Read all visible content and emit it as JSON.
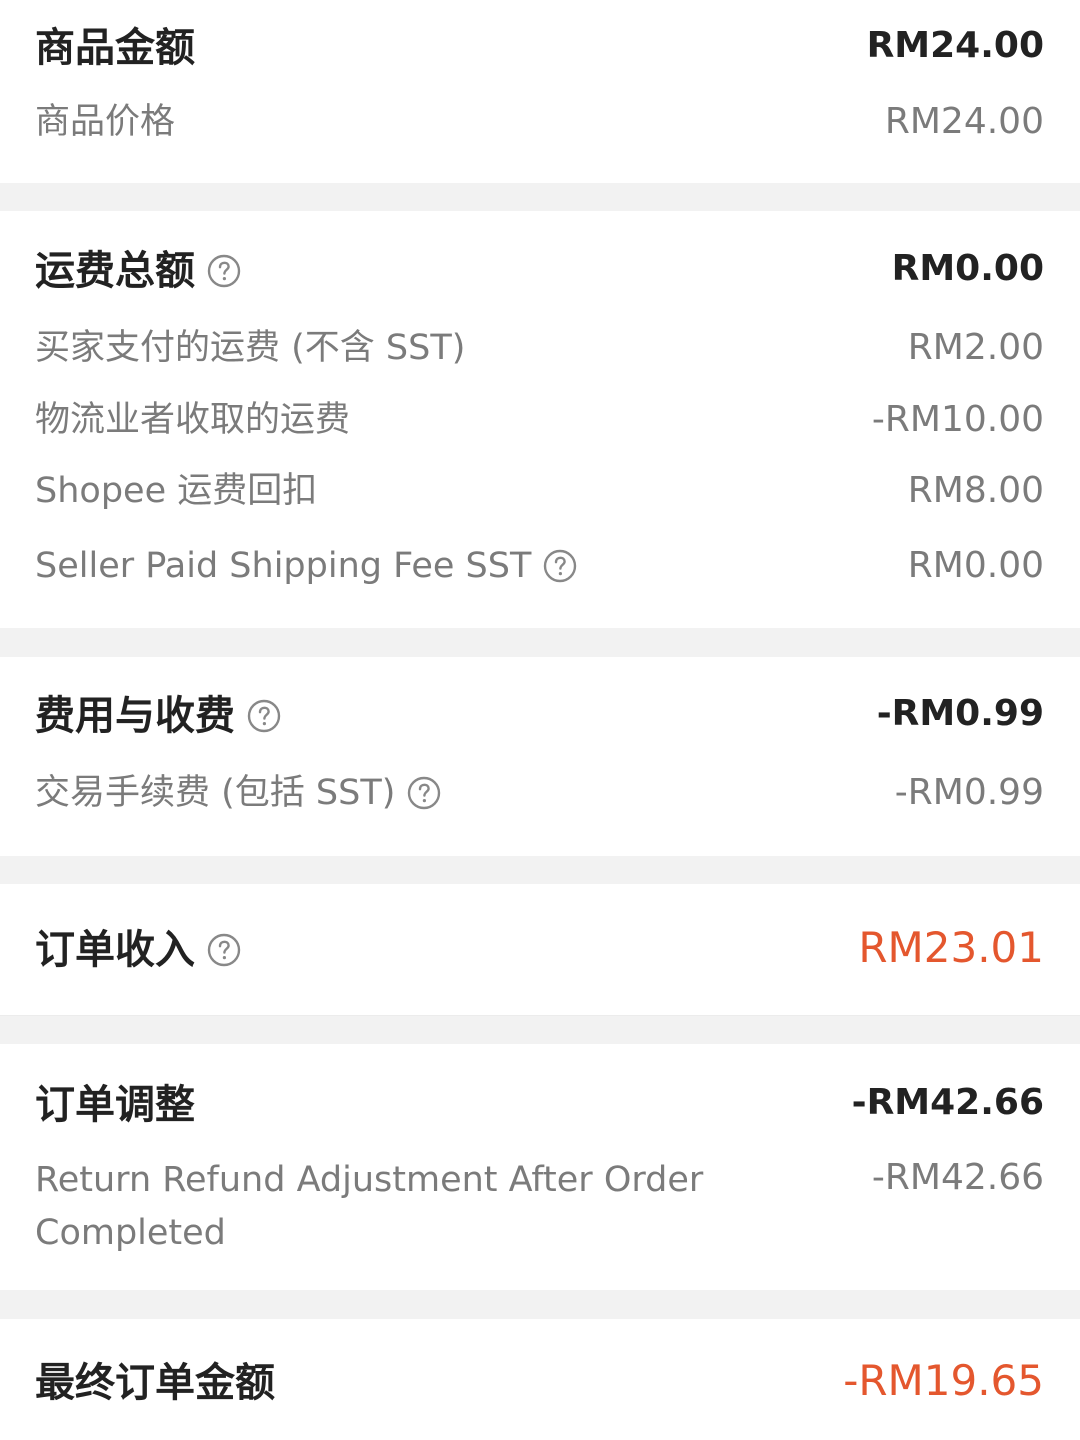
{
  "product": {
    "title": "商品金额",
    "total": "RM24.00",
    "items": [
      {
        "label": "商品价格",
        "value": "RM24.00"
      }
    ]
  },
  "shipping": {
    "title": "运费总额",
    "total": "RM0.00",
    "items": [
      {
        "label": "买家支付的运费 (不含 SST)",
        "value": "RM2.00"
      },
      {
        "label": "物流业者收取的运费",
        "value": "-RM10.00"
      },
      {
        "label": "Shopee 运费回扣",
        "value": "RM8.00"
      },
      {
        "label": "Seller Paid Shipping Fee SST",
        "value": "RM0.00"
      }
    ]
  },
  "fees": {
    "title": "费用与收费",
    "total": "-RM0.99",
    "items": [
      {
        "label": "交易手续费 (包括 SST)",
        "value": "-RM0.99"
      }
    ]
  },
  "income": {
    "title": "订单收入",
    "total": "RM23.01"
  },
  "adjustment": {
    "title": "订单调整",
    "total": "-RM42.66",
    "items": [
      {
        "label": "Return Refund Adjustment After Order Completed",
        "value": "-RM42.66"
      }
    ]
  },
  "final": {
    "title": "最终订单金额",
    "total": "-RM19.65"
  },
  "colors": {
    "accent": "#e4572e",
    "title_text": "#222222",
    "secondary_text": "#7b7b7b",
    "separator": "#f2f2f2"
  },
  "icons": {
    "help": "question-circle-icon"
  }
}
